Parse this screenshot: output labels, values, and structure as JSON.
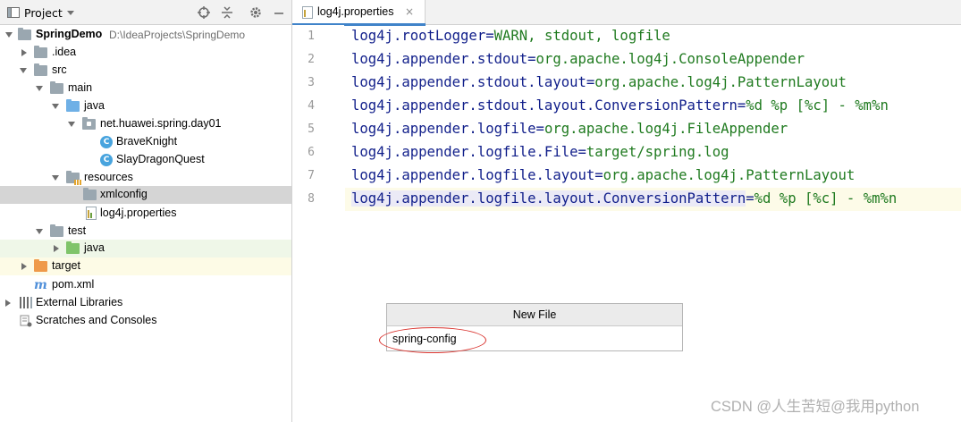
{
  "project_panel": {
    "title": "Project",
    "tree": [
      {
        "label": "SpringDemo",
        "path": "D:\\IdeaProjects\\SpringDemo"
      },
      {
        "label": ".idea"
      },
      {
        "label": "src"
      },
      {
        "label": "main"
      },
      {
        "label": "java"
      },
      {
        "label": "net.huawei.spring.day01"
      },
      {
        "label": "BraveKnight"
      },
      {
        "label": "SlayDragonQuest"
      },
      {
        "label": "resources"
      },
      {
        "label": "xmlconfig"
      },
      {
        "label": "log4j.properties"
      },
      {
        "label": "test"
      },
      {
        "label": "java"
      },
      {
        "label": "target"
      },
      {
        "label": "pom.xml"
      },
      {
        "label": "External Libraries"
      },
      {
        "label": "Scratches and Consoles"
      }
    ]
  },
  "editor": {
    "tab_label": "log4j.properties",
    "tab_close": "×",
    "lines": [
      {
        "num": "1",
        "key": "log4j.rootLogger",
        "eq": "=",
        "value": "WARN, stdout, logfile"
      },
      {
        "num": "2",
        "key": "log4j.appender.stdout",
        "eq": "=",
        "value": "org.apache.log4j.ConsoleAppender"
      },
      {
        "num": "3",
        "key": "log4j.appender.stdout.layout",
        "eq": "=",
        "value": "org.apache.log4j.PatternLayout"
      },
      {
        "num": "4",
        "key": "log4j.appender.stdout.layout.ConversionPattern",
        "eq": "=",
        "value": "%d %p [%c] - %m%n"
      },
      {
        "num": "5",
        "key": "log4j.appender.logfile",
        "eq": "=",
        "value": "org.apache.log4j.FileAppender"
      },
      {
        "num": "6",
        "key": "log4j.appender.logfile.File",
        "eq": "=",
        "value": "target/spring.log"
      },
      {
        "num": "7",
        "key": "log4j.appender.logfile.layout",
        "eq": "=",
        "value": "org.apache.log4j.PatternLayout"
      },
      {
        "num": "8",
        "key": "log4j.appender.logfile.layout.ConversionPattern",
        "eq": "=",
        "value": "%d %p [%c] - %m%n"
      }
    ]
  },
  "new_file_dialog": {
    "title": "New File",
    "input_value": "spring-config"
  },
  "watermark": "CSDN @人生苦短@我用python"
}
